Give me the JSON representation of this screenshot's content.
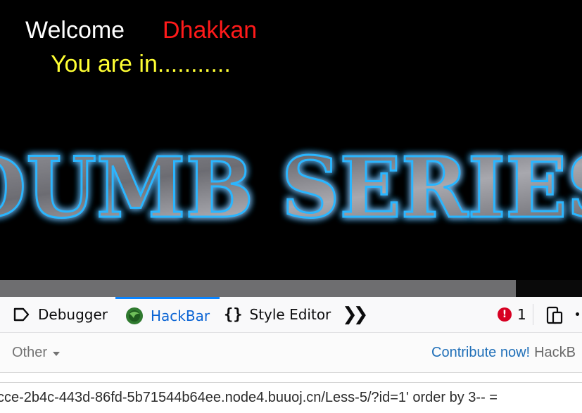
{
  "page": {
    "welcome": "Welcome",
    "username": "Dhakkan",
    "status": "You are in...........",
    "banner_text": "DUMB SERIES",
    "colors": {
      "background": "#000000",
      "welcome": "#ffffff",
      "username": "#ff1a1a",
      "status": "#ffff33",
      "banner_glow": "#1aa3ff"
    }
  },
  "devtools": {
    "tabs": [
      {
        "label": "Debugger",
        "icon": "debugger-icon",
        "active": false
      },
      {
        "label": "HackBar",
        "icon": "hackbar-icon",
        "active": true
      },
      {
        "label": "Style Editor",
        "icon": "braces-icon",
        "active": false
      }
    ],
    "more_icon": "chevron-double-right-icon",
    "error_count": "1",
    "accent": "#0a84ff"
  },
  "hackbar": {
    "dropdown": "Other",
    "contribute_link": "Contribute now!",
    "contribute_rest": "HackB",
    "url": "cce-2b4c-443d-86fd-5b71544b64ee.node4.buuoj.cn/Less-5/?id=1' order by 3-- ="
  }
}
